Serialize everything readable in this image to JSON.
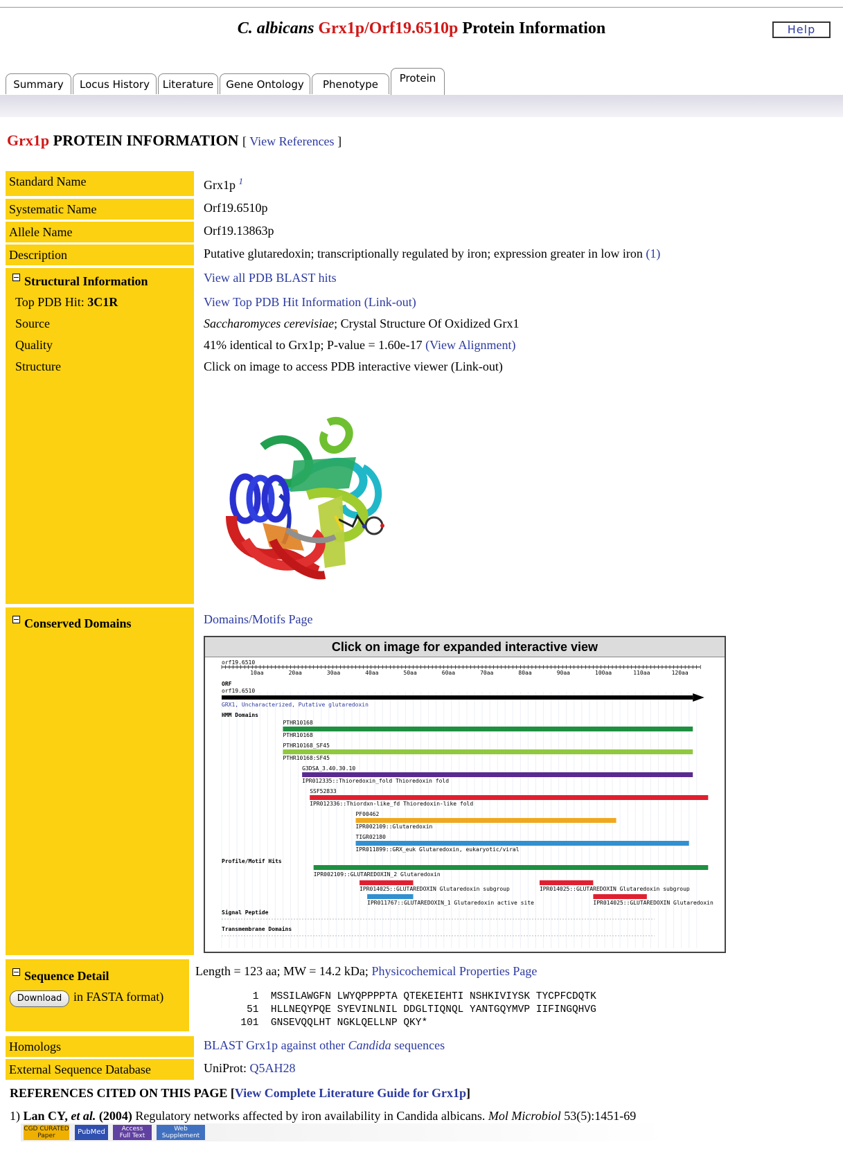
{
  "header": {
    "title_species": "C. albicans",
    "title_gene": "Grx1p/Orf19.6510p",
    "title_rest": "Protein Information",
    "help_label": "Help"
  },
  "tabs": [
    {
      "label": "Summary"
    },
    {
      "label": "Locus History"
    },
    {
      "label": "Literature"
    },
    {
      "label": "Gene Ontology"
    },
    {
      "label": "Phenotype"
    },
    {
      "label": "Protein"
    }
  ],
  "section": {
    "gene": "Grx1p",
    "title": "PROTEIN INFORMATION",
    "refs_open": "[",
    "refs_link": "View References",
    "refs_close": "]"
  },
  "rows": {
    "standard_name": {
      "label": "Standard Name",
      "value": "Grx1p",
      "sup": "1"
    },
    "systematic_name": {
      "label": "Systematic Name",
      "value": "Orf19.6510p"
    },
    "allele_name": {
      "label": "Allele Name",
      "value": "Orf19.13863p"
    },
    "description": {
      "label": "Description",
      "value": "Putative glutaredoxin; transcriptionally regulated by iron; expression greater in low iron",
      "link": "(1)"
    }
  },
  "structural": {
    "label": "Structural Information",
    "blast_link": "View all PDB BLAST hits",
    "top_hit_label": "Top PDB Hit:",
    "top_hit_id": "3C1R",
    "top_hit_link": "View Top PDB Hit Information (Link-out)",
    "source_label": "Source",
    "source_species": "Saccharomyces cerevisiae",
    "source_rest": "; Crystal Structure Of Oxidized Grx1",
    "quality_label": "Quality",
    "quality_value": "41% identical to Grx1p; P-value = 1.60e-17",
    "quality_link": "(View Alignment)",
    "structure_label": "Structure",
    "structure_value": "Click on image to access PDB interactive viewer (Link-out)"
  },
  "domains": {
    "label": "Conserved Domains",
    "page_link": "Domains/Motifs Page",
    "image_header": "Click on image for expanded interactive view",
    "ruler_name": "orf19.6510",
    "ticks": [
      "10aa",
      "20aa",
      "30aa",
      "40aa",
      "50aa",
      "60aa",
      "70aa",
      "80aa",
      "90aa",
      "100aa",
      "110aa",
      "120aa"
    ],
    "orf_label": "ORF",
    "orf_name": "orf19.6510",
    "orf_desc": "GRX1, Uncharacterized, Putative glutaredoxin",
    "hmm_label": "HMM Domains",
    "profile_label": "Profile/Motif Hits",
    "signal_label": "Signal Peptide",
    "tm_label": "Transmembrane Domains",
    "tracks": [
      {
        "top": "PTHR10168",
        "bottom": "PTHR10168",
        "color": "#1e9040",
        "start": 16,
        "end": 123
      },
      {
        "top": "PTHR10168_SF45",
        "bottom": "PTHR10168:SF45",
        "color": "#90c840",
        "start": 16,
        "end": 123
      },
      {
        "top": "G3DSA_3.40.30.10",
        "bottom": "IPR012335::Thioredoxin_fold Thioredoxin fold",
        "color": "#5a2a90",
        "start": 21,
        "end": 123
      },
      {
        "top": "SSF52833",
        "bottom": "IPR012336::Thiordxn-like_fd Thioredoxin-like fold",
        "color": "#e02030",
        "start": 23,
        "end": 127
      },
      {
        "top": "PF00462",
        "bottom": "IPR002109::Glutaredoxin",
        "color": "#f0a820",
        "start": 35,
        "end": 103
      },
      {
        "top": "TIGR02180",
        "bottom": "IPR011899::GRX_euk Glutaredoxin, eukaryotic/viral",
        "color": "#3090d0",
        "start": 35,
        "end": 122
      }
    ],
    "profile_bar": {
      "label": "IPR002109::GLUTAREDOXIN_2 Glutaredoxin",
      "color": "#1e9040",
      "start": 24,
      "end": 127
    },
    "motifs": [
      {
        "label": "IPR014025::GLUTAREDOXIN Glutaredoxin subgroup",
        "color": "#e02030",
        "start": 36,
        "end": 50
      },
      {
        "label": "IPR014025::GLUTAREDOXIN Glutaredoxin subgroup",
        "color": "#e02030",
        "start": 83,
        "end": 97
      },
      {
        "label": "IPR011767::GLUTAREDOXIN_1 Glutaredoxin active site",
        "color": "#3090d0",
        "start": 38,
        "end": 50
      },
      {
        "label": "IPR014025::GLUTAREDOXIN Glutaredoxin",
        "color": "#e02030",
        "start": 97,
        "end": 111
      }
    ]
  },
  "sequence": {
    "label": "Sequence Detail",
    "download_label": "Download",
    "download_suffix": "in FASTA format)",
    "length_text": "Length = 123 aa; MW = 14.2 kDa;",
    "props_link": "Physicochemical Properties Page",
    "lines": [
      "    1  MSSILAWGFN LWYQPPPPTA QTEKEIEHTI NSHKIVIYSK TYCPFCDQTK",
      "   51  HLLNEQYPQE SYEVINLNIL DDGLTIQNQL YANTGQYMVP IIFINGQHVG",
      "  101  GNSEVQQLHT NGKLQELLNP QKY*"
    ]
  },
  "homologs": {
    "label": "Homologs",
    "link_pre": "BLAST Grx1p against other",
    "link_ital": "Candida",
    "link_post": "sequences"
  },
  "external": {
    "label": "External Sequence Database",
    "prefix": "UniProt:",
    "link": "Q5AH28"
  },
  "references": {
    "heading_pre": "REFERENCES CITED ON THIS PAGE [",
    "heading_link": "View Complete Literature Guide for Grx1p",
    "heading_post": "]",
    "items": [
      {
        "num": "1)",
        "author": "Lan CY,",
        "etal": "et al.",
        "year": "(2004)",
        "title": "Regulatory networks affected by iron availability in Candida albicans.",
        "journal": "Mol Microbiol",
        "cite": "53(5):1451-69"
      }
    ],
    "badges": [
      {
        "line1": "CGD CURATED",
        "line2": "Paper",
        "color": "#f0b000"
      },
      {
        "line1": "PubMed",
        "line2": "",
        "color": "#3050b0"
      },
      {
        "line1": "Access",
        "line2": "Full Text",
        "color": "#6040a0"
      },
      {
        "line1": "Web",
        "line2": "Supplement",
        "color": "#4070c0"
      }
    ]
  }
}
